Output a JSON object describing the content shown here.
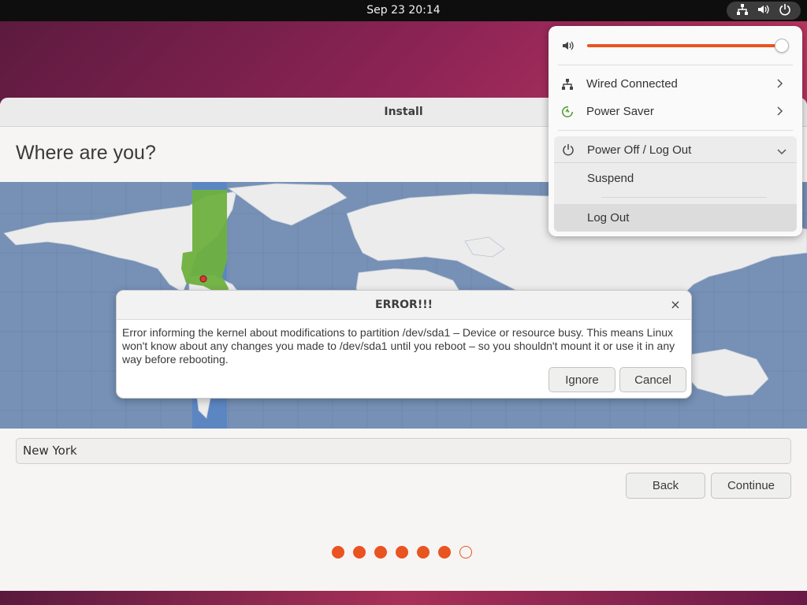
{
  "topbar": {
    "clock": "Sep 23  20:14",
    "tray_icons": [
      "network-wired-icon",
      "volume-icon",
      "power-icon"
    ]
  },
  "window": {
    "title": "Install",
    "page_title": "Where are you?",
    "timezone_value": "New York",
    "back_label": "Back",
    "continue_label": "Continue",
    "progress": {
      "total_steps": 7,
      "completed_steps": 6
    }
  },
  "dialog": {
    "title": "ERROR!!!",
    "message": "Error informing the kernel about modifications to partition /dev/sda1 – Device or resource busy. This means Linux won't know about any changes you made to /dev/sda1 until you reboot – so you shouldn't mount it or use it in any way before rebooting.",
    "close_glyph": "×",
    "ignore_label": "Ignore",
    "cancel_label": "Cancel"
  },
  "quick_settings": {
    "volume_level": 1.0,
    "items": [
      {
        "label": "Wired Connected",
        "icon": "network-wired-icon"
      },
      {
        "label": "Power Saver",
        "icon": "power-saver-icon"
      }
    ],
    "power_menu": {
      "label": "Power Off / Log Out",
      "icon": "power-icon",
      "subitems": [
        "Suspend",
        "Log Out"
      ]
    }
  },
  "colors": {
    "accent": "#e95420",
    "topbar": "#0e0e0e",
    "map_water": "#7690b6",
    "map_land": "#ececec",
    "selected_zone": "#6fb13f"
  }
}
